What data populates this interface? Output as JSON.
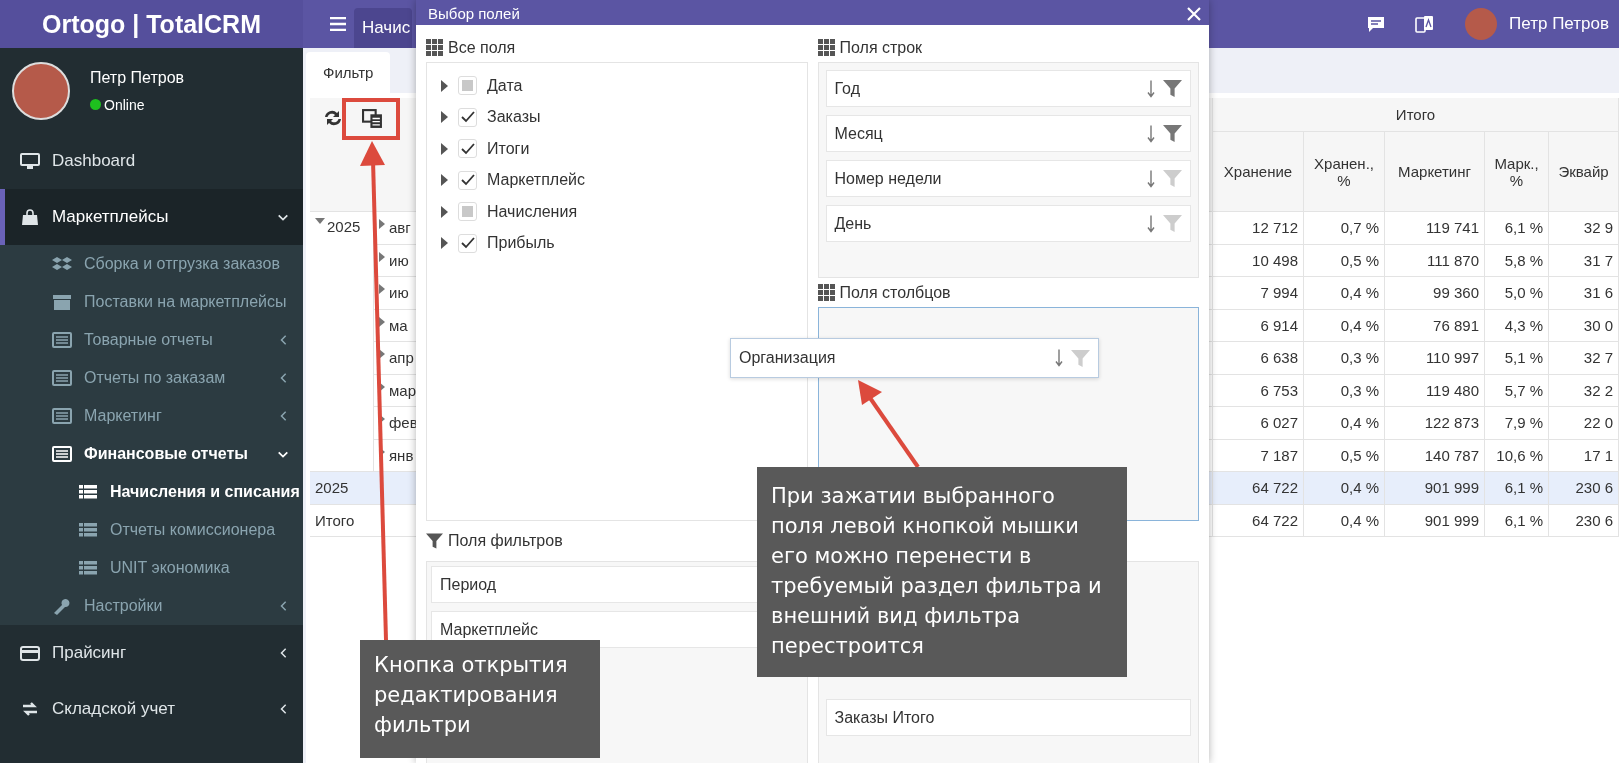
{
  "sidebar": {
    "logo": "Ortogo | TotalCRM",
    "user": {
      "name": "Петр Петров",
      "status": "Online"
    },
    "menu": [
      {
        "label": "Dashboard",
        "selected": false
      },
      {
        "label": "Маркетплейсы",
        "selected": true,
        "expanded": true,
        "children": [
          {
            "label": "Сборка и отгрузка заказов",
            "selected": false
          },
          {
            "label": "Поставки на маркетплейсы",
            "selected": false
          },
          {
            "label": "Товарные отчеты",
            "selected": false,
            "expanded": false
          },
          {
            "label": "Отчеты по заказам",
            "selected": false,
            "expanded": false
          },
          {
            "label": "Маркетинг",
            "selected": false,
            "expanded": false
          },
          {
            "label": "Финансовые отчеты",
            "selected": true,
            "expanded": true,
            "children": [
              {
                "label": "Начисления и списания",
                "selected": true
              },
              {
                "label": "Отчеты комиссионера",
                "selected": false
              },
              {
                "label": "UNIT экономика",
                "selected": false
              }
            ]
          },
          {
            "label": "Настройки",
            "selected": false,
            "expanded": false
          }
        ]
      },
      {
        "label": "Прайсинг",
        "selected": false,
        "expanded": false
      },
      {
        "label": "Складской учет",
        "selected": false,
        "expanded": false
      }
    ]
  },
  "topbar": {
    "tab": "Начис",
    "user": "Петр Петров"
  },
  "tabs": [
    {
      "label": "Фильтр",
      "selected": true
    }
  ],
  "table": {
    "group_header": "Итого",
    "columns": [
      "Хранение",
      "Хранен., %",
      "Маркетинг",
      "Марк., %",
      "Эквайр"
    ],
    "year": "2025",
    "rows": [
      {
        "label": "авг",
        "values": [
          "12 712",
          "0,7 %",
          "119 741",
          "6,1 %",
          "32 9"
        ]
      },
      {
        "label": "ию",
        "values": [
          "10 498",
          "0,5 %",
          "111 870",
          "5,8 %",
          "31 7"
        ]
      },
      {
        "label": "ию",
        "values": [
          "7 994",
          "0,4 %",
          "99 360",
          "5,0 %",
          "31 6"
        ]
      },
      {
        "label": "ма",
        "values": [
          "6 914",
          "0,4 %",
          "76 891",
          "4,3 %",
          "30 0"
        ]
      },
      {
        "label": "апр",
        "values": [
          "6 638",
          "0,3 %",
          "110 997",
          "5,1 %",
          "32 7"
        ]
      },
      {
        "label": "мар",
        "values": [
          "6 753",
          "0,3 %",
          "119 480",
          "5,7 %",
          "32 2"
        ]
      },
      {
        "label": "фев",
        "values": [
          "6 027",
          "0,4 %",
          "122 873",
          "7,9 %",
          "22 0"
        ]
      },
      {
        "label": "янв",
        "values": [
          "7 187",
          "0,5 %",
          "140 787",
          "10,6 %",
          "17 1"
        ]
      }
    ],
    "subtotal": {
      "label": "2025",
      "values": [
        "64 722",
        "0,4 %",
        "901 999",
        "6,1 %",
        "230 6"
      ]
    },
    "total": {
      "label": "Итого",
      "values": [
        "64 722",
        "0,4 %",
        "901 999",
        "6,1 %",
        "230 6"
      ]
    }
  },
  "dialog": {
    "title": "Выбор полей",
    "all_fields": {
      "title": "Все поля",
      "items": [
        {
          "label": "Дата",
          "checked": false
        },
        {
          "label": "Заказы",
          "checked": true
        },
        {
          "label": "Итоги",
          "checked": true
        },
        {
          "label": "Маркетплейс",
          "checked": true
        },
        {
          "label": "Начисления",
          "checked": false
        },
        {
          "label": "Прибыль",
          "checked": true
        }
      ]
    },
    "filter_fields": {
      "title": "Поля фильтров",
      "items": [
        {
          "label": "Период"
        },
        {
          "label": "Маркетплейс"
        }
      ]
    },
    "row_fields": {
      "title": "Поля строк",
      "items": [
        {
          "label": "Год",
          "filtered": true
        },
        {
          "label": "Месяц",
          "filtered": true
        },
        {
          "label": "Номер недели",
          "filtered": false
        },
        {
          "label": "День",
          "filtered": false
        }
      ]
    },
    "column_fields": {
      "title": "Поля столбцов"
    },
    "data_fields": {
      "items": [
        {
          "label": "Заказы Итого"
        }
      ]
    },
    "dragged_field": {
      "label": "Организация",
      "filtered": false
    }
  },
  "annotations": [
    {
      "text": "Кнопка открытия редактирования фильтри"
    },
    {
      "text": "При зажатии выбранного поля левой кнопкой мышки его можно перенести в требуемый раздел фильтра и внешний вид фильтра перестроится"
    }
  ]
}
